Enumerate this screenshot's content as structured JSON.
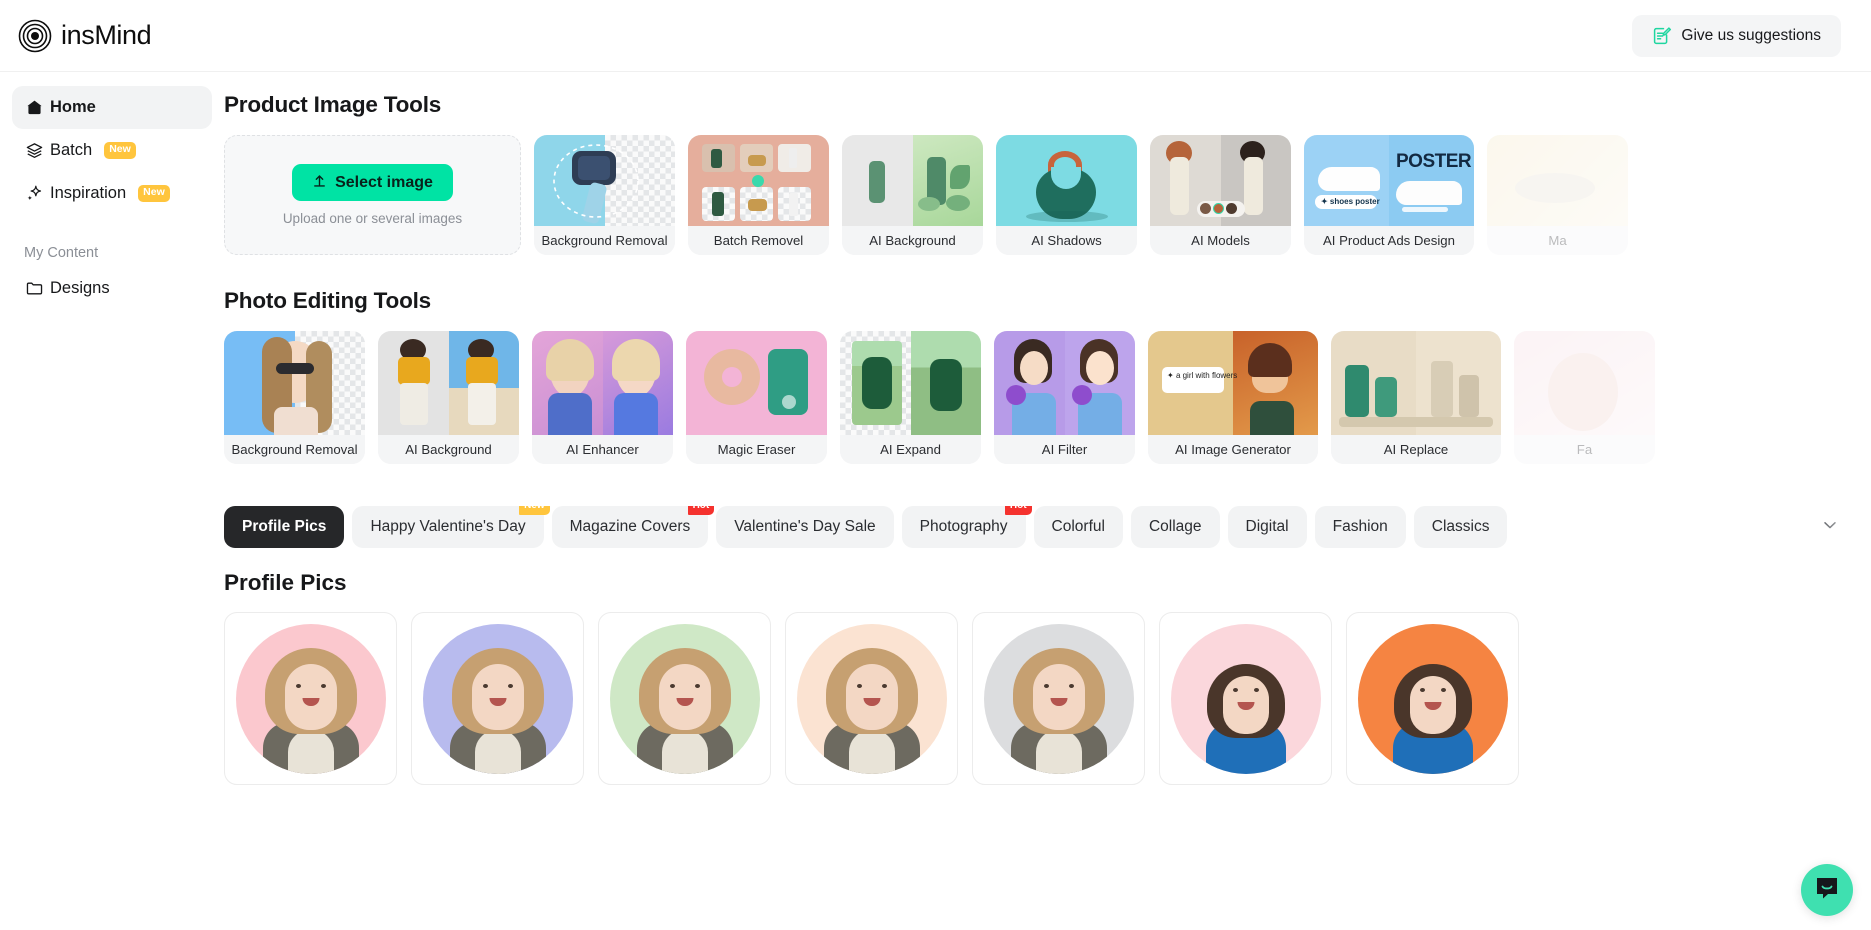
{
  "header": {
    "logo_text": "insMind",
    "logo_icon": "concentric-circles-logo",
    "suggestions_label": "Give us suggestions",
    "suggestions_icon": "edit-note-icon"
  },
  "sidebar": {
    "items": [
      {
        "label": "Home",
        "icon": "home-icon",
        "active": true,
        "badge": ""
      },
      {
        "label": "Batch",
        "icon": "layers-icon",
        "active": false,
        "badge": "New"
      },
      {
        "label": "Inspiration",
        "icon": "sparkle-icon",
        "active": false,
        "badge": "New"
      }
    ],
    "section_label": "My Content",
    "content_items": [
      {
        "label": "Designs",
        "icon": "folder-icon"
      }
    ]
  },
  "product_section": {
    "title": "Product Image Tools",
    "upload": {
      "button_label": "Select image",
      "button_icon": "upload-arrow-icon",
      "hint": "Upload one or several images",
      "accent_color": "#00E3A4"
    },
    "tools": [
      {
        "label": "Background Removal",
        "thumb": "watch-cutout",
        "bg": "#8FD6EA"
      },
      {
        "label": "Batch Removel",
        "thumb": "batch-grid",
        "bg": "#E5AE9C"
      },
      {
        "label": "AI Background",
        "thumb": "bottle-scene",
        "bg": "#BFE3B8"
      },
      {
        "label": "AI Shadows",
        "thumb": "green-bag",
        "bg": "#7DDBE3"
      },
      {
        "label": "AI Models",
        "thumb": "two-models",
        "bg": "#E9E6E0"
      },
      {
        "label": "AI Product Ads Design",
        "thumb": "shoe-poster",
        "bg": "#9CD2F5"
      },
      {
        "label": "Ma",
        "thumb": "faded-card",
        "bg": "#F2E6C8"
      }
    ]
  },
  "photo_section": {
    "title": "Photo Editing Tools",
    "tools": [
      {
        "label": "Background Removal",
        "thumb": "woman-sunglasses-cutout",
        "bg": "#77BDF5"
      },
      {
        "label": "AI Background",
        "thumb": "yellow-shirt-beach",
        "bg": "#E3E3E3"
      },
      {
        "label": "AI Enhancer",
        "thumb": "blonde-pink-purple",
        "bg": "#D9A0D8"
      },
      {
        "label": "Magic Eraser",
        "thumb": "donut-pink",
        "bg": "#F2B8D8"
      },
      {
        "label": "AI Expand",
        "thumb": "green-hoodie-fence",
        "bg": "#9FD4A8"
      },
      {
        "label": "AI Filter",
        "thumb": "girl-tulips",
        "bg": "#B79BE8"
      },
      {
        "label": "AI Image Generator",
        "thumb": "girl-with-flowers-prompt",
        "bg": "#E4C88D",
        "prompt_text": "a girl with flowers"
      },
      {
        "label": "AI Replace",
        "thumb": "bottle-replace",
        "bg": "#E6D9C4"
      },
      {
        "label": "Fa",
        "thumb": "faded-card",
        "bg": "#F2D9DE"
      }
    ]
  },
  "tabs": {
    "items": [
      {
        "label": "Profile Pics",
        "badge": "",
        "active": true
      },
      {
        "label": "Happy Valentine's Day",
        "badge": "New",
        "active": false
      },
      {
        "label": "Magazine Covers",
        "badge": "Hot",
        "active": false
      },
      {
        "label": "Valentine's Day Sale",
        "badge": "",
        "active": false
      },
      {
        "label": "Photography",
        "badge": "Hot",
        "active": false
      },
      {
        "label": "Colorful",
        "badge": "",
        "active": false
      },
      {
        "label": "Collage",
        "badge": "",
        "active": false
      },
      {
        "label": "Digital",
        "badge": "",
        "active": false
      },
      {
        "label": "Fashion",
        "badge": "",
        "active": false
      },
      {
        "label": "Classics",
        "badge": "",
        "active": false
      }
    ],
    "expand_icon": "chevron-down-icon"
  },
  "gallery": {
    "title": "Profile Pics",
    "items": [
      {
        "bg": "#FBC8CE",
        "subject": "blonde-woman"
      },
      {
        "bg": "#B8BBEE",
        "subject": "blonde-woman"
      },
      {
        "bg": "#CFE8C6",
        "subject": "blonde-woman"
      },
      {
        "bg": "#FBE3D2",
        "subject": "blonde-woman"
      },
      {
        "bg": "#DCDDDF",
        "subject": "blonde-woman"
      },
      {
        "bg": "#FBD7DC",
        "subject": "brunette-woman"
      },
      {
        "bg": "#F58442",
        "subject": "brunette-woman"
      }
    ]
  },
  "chat": {
    "icon": "chat-bubble-icon",
    "color": "#3FE0B0"
  }
}
